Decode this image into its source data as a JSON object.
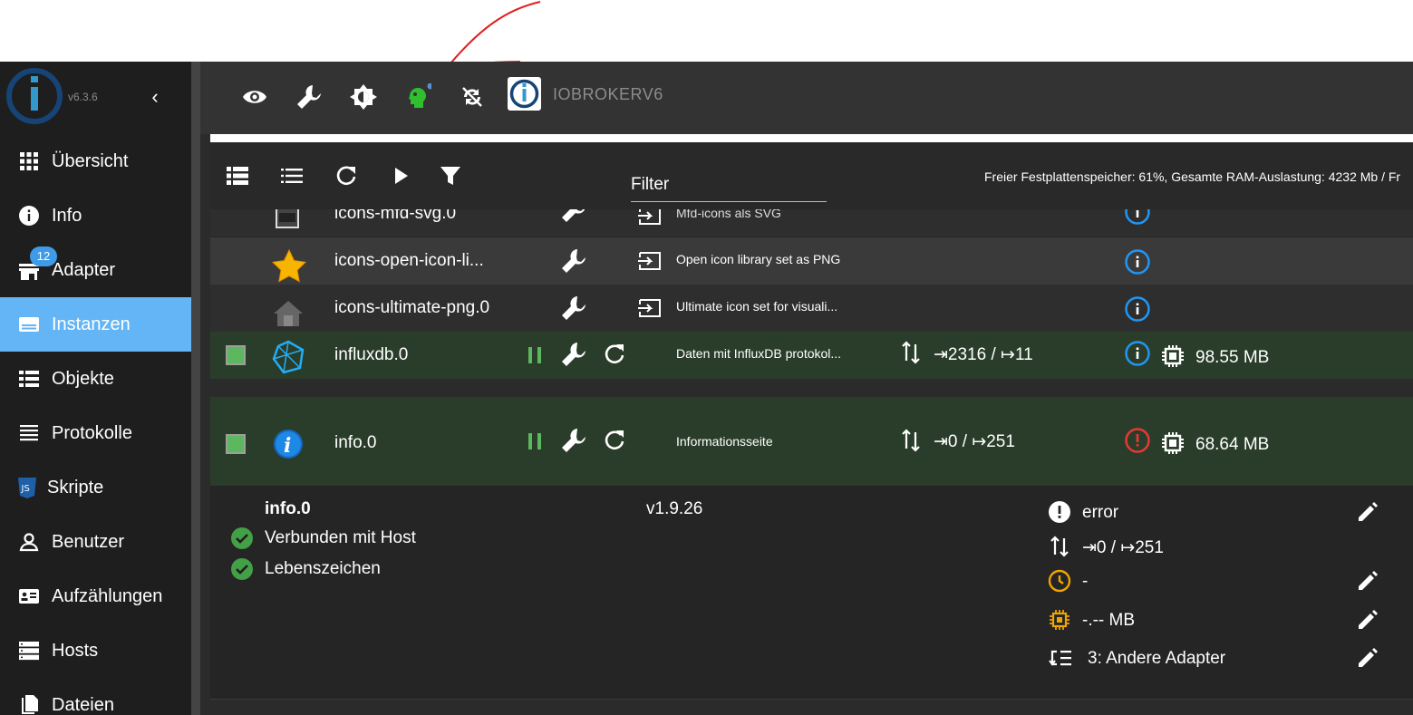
{
  "app": {
    "version": "v6.3.6",
    "hostname": "IOBROKERV6",
    "accent": "#64b5f6",
    "running_green": "#2a3d2a"
  },
  "sidebar": {
    "items": [
      {
        "label": "Übersicht",
        "icon": "grid-icon"
      },
      {
        "label": "Info",
        "icon": "info-icon"
      },
      {
        "label": "Adapter",
        "icon": "store-icon",
        "badge": "12"
      },
      {
        "label": "Instanzen",
        "icon": "instances-icon",
        "active": true
      },
      {
        "label": "Objekte",
        "icon": "list-icon"
      },
      {
        "label": "Protokolle",
        "icon": "log-icon"
      },
      {
        "label": "Skripte",
        "icon": "js-icon"
      },
      {
        "label": "Benutzer",
        "icon": "user-icon"
      },
      {
        "label": "Aufzählungen",
        "icon": "enum-icon"
      },
      {
        "label": "Hosts",
        "icon": "hosts-icon"
      },
      {
        "label": "Dateien",
        "icon": "files-icon"
      }
    ]
  },
  "toolbar": {
    "icons": [
      "eye-icon",
      "wrench-icon",
      "brightness-icon",
      "expert-mode-icon",
      "sync-off-icon"
    ]
  },
  "instances": {
    "filter_label": "Filter",
    "sysinfo": "Freier Festplattenspeicher: 61%, Gesamte RAM-Auslastung: 4232 Mb / Fr",
    "rows": [
      {
        "name": "icons-mfd-svg.0",
        "desc": "Mfd-icons als SVG"
      },
      {
        "name": "icons-open-icon-li...",
        "desc": "Open icon library set as PNG"
      },
      {
        "name": "icons-ultimate-png.0",
        "desc": "Ultimate icon set for visuali..."
      },
      {
        "name": "influxdb.0",
        "desc": "Daten mit InfluxDB protokol...",
        "events": "⇥2316 / ↦11",
        "memory": "98.55 MB"
      },
      {
        "name": "info.0",
        "desc": "Informationsseite",
        "events": "⇥0 / ↦251",
        "memory": "68.64 MB"
      }
    ]
  },
  "detail": {
    "title": "info.0",
    "version": "v1.9.26",
    "checks": [
      "Verbunden mit Host",
      "Lebenszeichen"
    ],
    "status": "error",
    "events": "⇥0 / ↦251",
    "schedule": "-",
    "memory_limit": "-.-- MB",
    "tier": "3: Andere Adapter"
  }
}
